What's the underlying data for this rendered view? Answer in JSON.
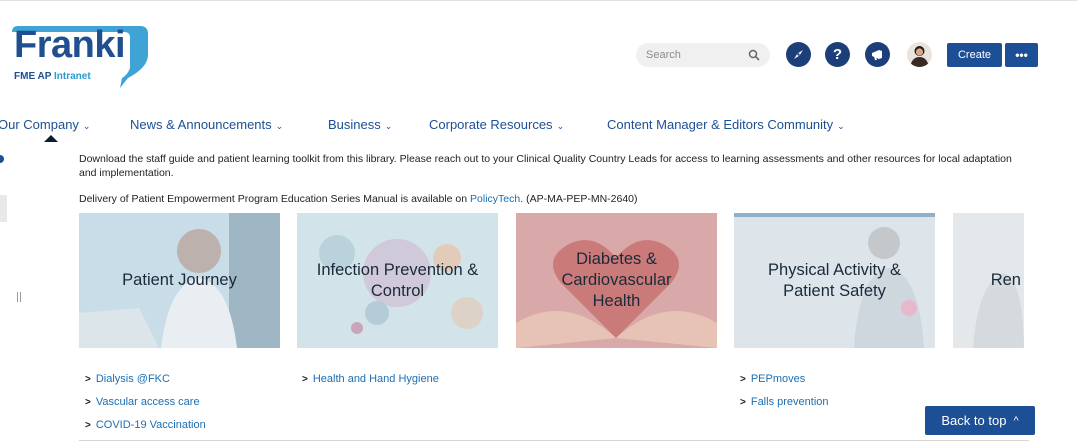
{
  "logo": {
    "word": "Franki",
    "tag_prefix": "FME AP ",
    "tag_suffix": "Intranet"
  },
  "header": {
    "search_placeholder": "Search",
    "help_glyph": "?",
    "create_label": "Create",
    "more_label": "•••"
  },
  "nav": {
    "items": [
      {
        "label": "Our Company"
      },
      {
        "label": "News & Announcements"
      },
      {
        "label": "Business"
      },
      {
        "label": "Corporate Resources"
      },
      {
        "label": "Content Manager & Editors Community"
      }
    ],
    "chevron": "⌄"
  },
  "content": {
    "intro": "Download the staff guide and patient learning toolkit from this library. Please reach out to your Clinical Quality Country Leads for access to learning assessments and other resources for local adaptation and implementation.",
    "delivery_prefix": "Delivery of Patient Empowerment Program Education Series Manual is available on ",
    "delivery_link": "PolicyTech",
    "delivery_suffix": ". (AP-MA-PEP-MN-2640)",
    "tiles": [
      {
        "label": "Patient Journey"
      },
      {
        "label": "Infection Prevention & Control"
      },
      {
        "label": "Diabetes & Cardiovascular Health"
      },
      {
        "label": "Physical Activity & Patient Safety"
      },
      {
        "label": "Ren"
      }
    ],
    "links": {
      "col1": [
        "Dialysis @FKC",
        "Vascular access care",
        "COVID-19 Vaccination"
      ],
      "col2": [
        "Health and Hand Hygiene"
      ],
      "col4": [
        "PEPmoves",
        "Falls prevention"
      ]
    },
    "link_marker": ">"
  },
  "back_to_top": {
    "label": "Back to top",
    "glyph": "^"
  },
  "colors": {
    "brand": "#1c4f96",
    "dark_icon": "#1c3f7a",
    "link": "#1c6fb3"
  },
  "icons": [
    "search-icon",
    "compass-icon",
    "help-icon",
    "megaphone-icon",
    "avatar",
    "chevron-down-icon",
    "chevron-up-icon"
  ]
}
